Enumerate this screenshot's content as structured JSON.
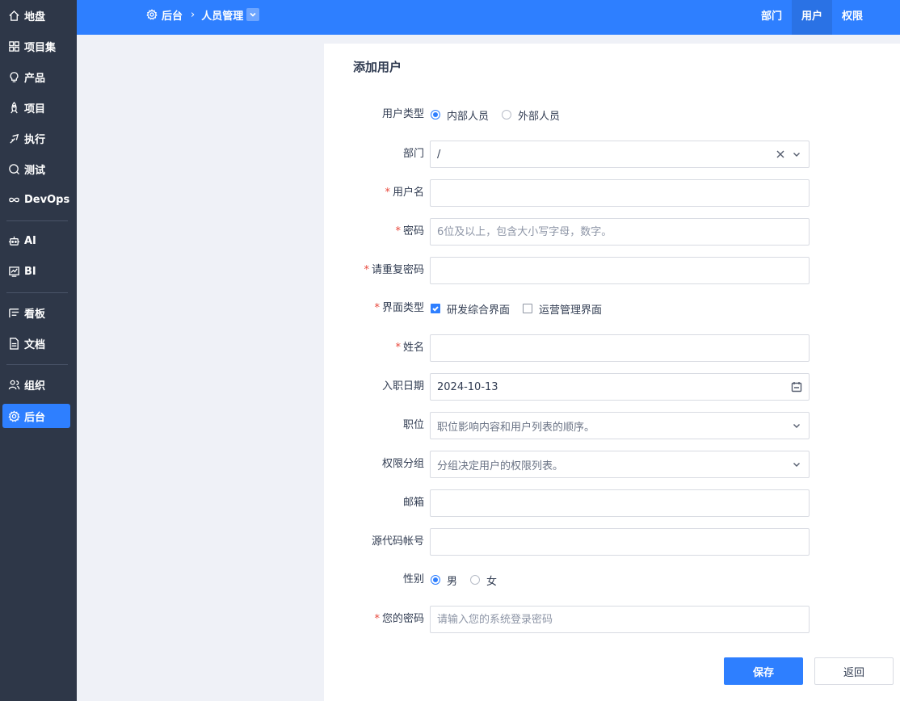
{
  "sidebar": {
    "items": [
      {
        "label": "地盘",
        "icon": "home-icon"
      },
      {
        "label": "项目集",
        "icon": "grid-icon"
      },
      {
        "label": "产品",
        "icon": "bulb-icon"
      },
      {
        "label": "项目",
        "icon": "rocket-icon"
      },
      {
        "label": "执行",
        "icon": "run-icon"
      },
      {
        "label": "测试",
        "icon": "bug-search-icon"
      },
      {
        "label": "DevOps",
        "icon": "infinity-icon"
      },
      {
        "label": "AI",
        "icon": "robot-icon"
      },
      {
        "label": "BI",
        "icon": "chart-icon"
      },
      {
        "label": "看板",
        "icon": "kanban-icon"
      },
      {
        "label": "文档",
        "icon": "document-icon"
      },
      {
        "label": "组织",
        "icon": "people-icon"
      },
      {
        "label": "后台",
        "icon": "gear-icon"
      }
    ],
    "active": "后台"
  },
  "header": {
    "breadcrumb_root": "后台",
    "breadcrumb_current": "人员管理",
    "tabs": [
      {
        "label": "部门"
      },
      {
        "label": "用户"
      },
      {
        "label": "权限"
      }
    ],
    "active_tab": "用户"
  },
  "form": {
    "title": "添加用户",
    "user_type": {
      "label": "用户类型",
      "options": [
        "内部人员",
        "外部人员"
      ],
      "selected": "内部人员"
    },
    "dept": {
      "label": "部门",
      "value": "/"
    },
    "account": {
      "label": "用户名",
      "value": ""
    },
    "password": {
      "label": "密码",
      "placeholder": "6位及以上，包含大小写字母，数字。"
    },
    "password2": {
      "label": "请重复密码",
      "value": ""
    },
    "vision": {
      "label": "界面类型",
      "options": [
        "研发综合界面",
        "运营管理界面"
      ],
      "checked": [
        "研发综合界面"
      ]
    },
    "realname": {
      "label": "姓名",
      "value": ""
    },
    "join": {
      "label": "入职日期",
      "value": "2024-10-13"
    },
    "role": {
      "label": "职位",
      "placeholder": "职位影响内容和用户列表的顺序。"
    },
    "group": {
      "label": "权限分组",
      "placeholder": "分组决定用户的权限列表。"
    },
    "email": {
      "label": "邮箱",
      "value": ""
    },
    "commiter": {
      "label": "源代码帐号",
      "value": ""
    },
    "gender": {
      "label": "性别",
      "options": [
        "男",
        "女"
      ],
      "selected": "男"
    },
    "verify": {
      "label": "您的密码",
      "placeholder": "请输入您的系统登录密码"
    },
    "save_label": "保存",
    "back_label": "返回"
  },
  "colors": {
    "primary": "#2e7fff",
    "sidebar_bg": "#2e3748",
    "required": "#e8463a"
  }
}
